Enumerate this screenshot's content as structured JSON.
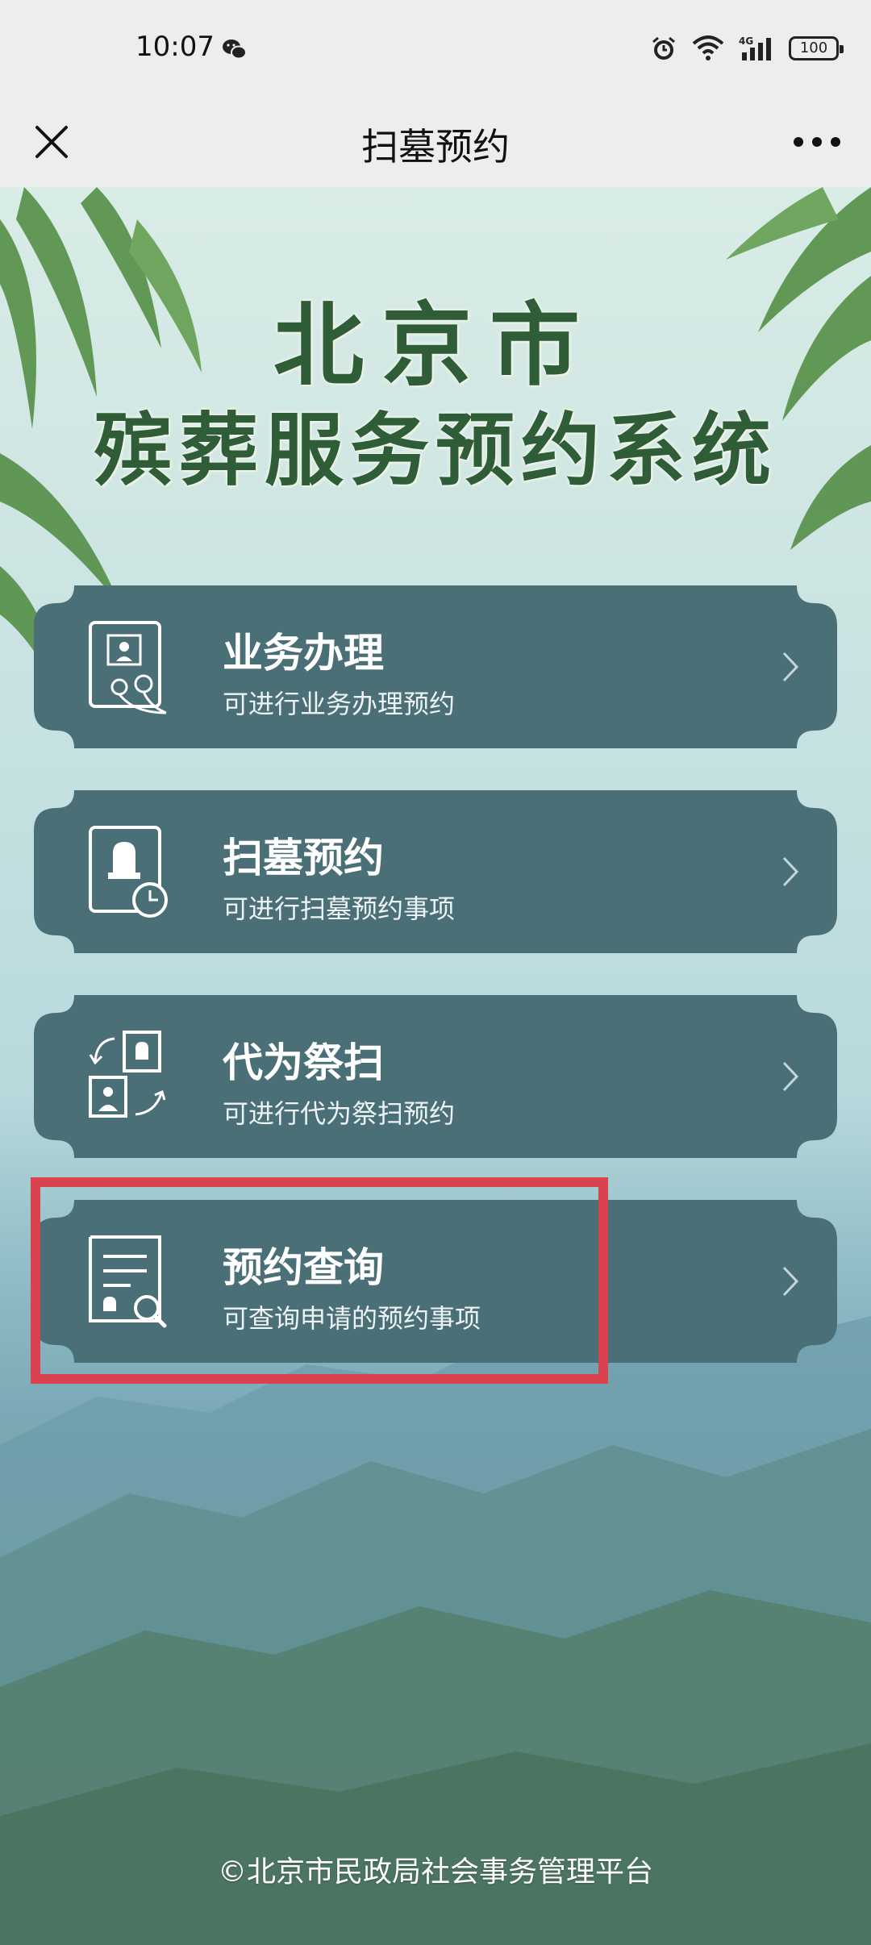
{
  "status_bar": {
    "time": "10:07",
    "network": "4G",
    "battery": "100"
  },
  "nav": {
    "title": "扫墓预约"
  },
  "header": {
    "line1": "北京市",
    "line2": "殡葬服务预约系统"
  },
  "cards": [
    {
      "title": "业务办理",
      "subtitle": "可进行业务办理预约",
      "icon": "portrait-flower-icon"
    },
    {
      "title": "扫墓预约",
      "subtitle": "可进行扫墓预约事项",
      "icon": "tombstone-clock-icon"
    },
    {
      "title": "代为祭扫",
      "subtitle": "可进行代为祭扫预约",
      "icon": "proxy-exchange-icon"
    },
    {
      "title": "预约查询",
      "subtitle": "可查询申请的预约事项",
      "icon": "document-search-icon"
    }
  ],
  "footer": {
    "text": "©北京市民政局社会事务管理平台"
  },
  "colors": {
    "card": "#4a6f77",
    "title_green": "#2f5d37",
    "highlight": "#d9424e"
  }
}
